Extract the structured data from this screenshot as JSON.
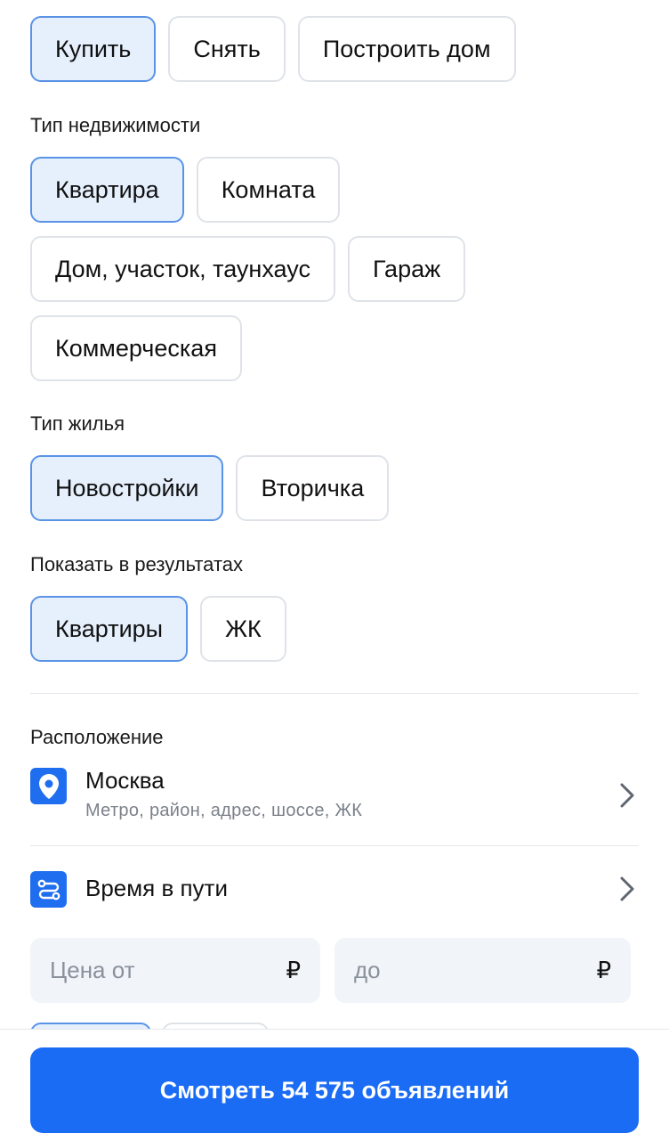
{
  "deal_types": [
    {
      "label": "Купить",
      "active": true
    },
    {
      "label": "Снять",
      "active": false
    },
    {
      "label": "Построить дом",
      "active": false
    }
  ],
  "property_type": {
    "label": "Тип недвижимости",
    "options": [
      {
        "label": "Квартира",
        "active": true
      },
      {
        "label": "Комната",
        "active": false
      },
      {
        "label": "Дом, участок, таунхаус",
        "active": false
      },
      {
        "label": "Гараж",
        "active": false
      },
      {
        "label": "Коммерческая",
        "active": false
      }
    ]
  },
  "housing_type": {
    "label": "Тип жилья",
    "options": [
      {
        "label": "Новостройки",
        "active": true
      },
      {
        "label": "Вторичка",
        "active": false
      }
    ]
  },
  "show_results": {
    "label": "Показать в результатах",
    "options": [
      {
        "label": "Квартиры",
        "active": true
      },
      {
        "label": "ЖК",
        "active": false
      }
    ]
  },
  "location": {
    "label": "Расположение",
    "city": "Москва",
    "hint": "Метро, район, адрес, шоссе, ЖК",
    "icon": "location-pin-icon"
  },
  "travel_time": {
    "label": "Время в пути",
    "icon": "route-icon"
  },
  "price": {
    "from_placeholder": "Цена от",
    "to_placeholder": "до",
    "currency": "₽"
  },
  "cta": {
    "label": "Смотреть 54 575 объявлений"
  },
  "colors": {
    "accent": "#1a6cf5",
    "active_chip_bg": "#e6f0fd",
    "active_chip_border": "#5a93e6"
  }
}
